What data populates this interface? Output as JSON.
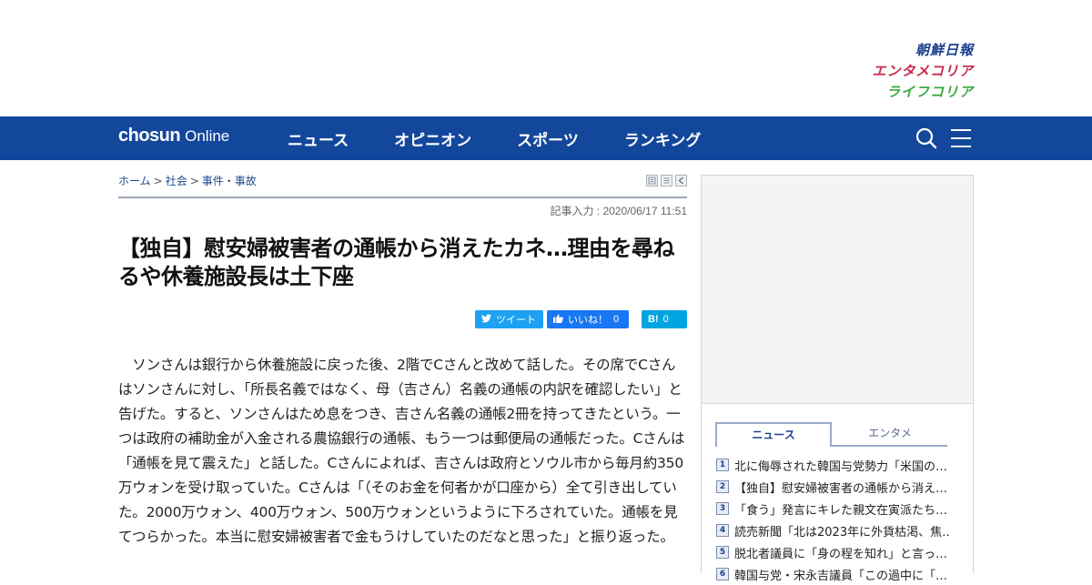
{
  "brands": {
    "chosun_ilbo": "朝鮮日報",
    "entame_korea": "エンタメコリア",
    "life_korea": "ライフコリア"
  },
  "nav": {
    "logo_main": "chosun",
    "logo_sub": "Online",
    "items": [
      "ニュース",
      "オピニオン",
      "スポーツ",
      "ランキング"
    ],
    "search_icon": "search-icon",
    "menu_icon": "menu-icon"
  },
  "breadcrumb": {
    "home": "ホーム",
    "section": "社会",
    "category": "事件・事故",
    "separator": ">"
  },
  "article": {
    "date": "記事入力 : 2020/06/17 11:51",
    "headline": "【独自】慰安婦被害者の通帳から消えたカネ…理由を尋ねるや休養施設長は土下座",
    "body": "　ソンさんは銀行から休養施設に戻った後、2階でCさんと改めて話した。その席でCさんはソンさんに対し、「所長名義ではなく、母（吉さん）名義の通帳の内訳を確認したい」と告げた。すると、ソンさんはため息をつき、吉さん名義の通帳2冊を持ってきたという。一つは政府の補助金が入金される農協銀行の通帳、もう一つは郵便局の通帳だった。Cさんは「通帳を見て震えた」と話した。Cさんによれば、吉さんは政府とソウル市から毎月約350万ウォンを受け取っていた。Cさんは「（そのお金を何者かが口座から）全て引き出していた。2000万ウォン、400万ウォン、500万ウォンというように下ろされていた。通帳を見てつらかった。本当に慰安婦被害者で金もうけしていたのだなと思った」と振り返った。"
  },
  "share": {
    "tweet": "ツイート",
    "like": "いいね！",
    "like_count": "0",
    "hatena": "B!",
    "hatena_count": "0"
  },
  "sidebar": {
    "tabs": [
      "ニュース",
      "エンタメ"
    ],
    "ranking": [
      {
        "num": "1",
        "title": "北に侮辱された韓国与党勢力「米国の…"
      },
      {
        "num": "2",
        "title": "【独自】慰安婦被害者の通帳から消え…"
      },
      {
        "num": "3",
        "title": "「食う」発言にキレた親文在寅派たち…"
      },
      {
        "num": "4",
        "title": "読売新聞「北は2023年に外貨枯渇、焦…"
      },
      {
        "num": "5",
        "title": "脱北者議員に「身の程を知れ」と言っ…"
      },
      {
        "num": "6",
        "title": "韓国与党・宋永吉議員「この過中に「…"
      }
    ]
  },
  "colors": {
    "nav_bg": "#13479c",
    "brand_blue": "#1a3f8f",
    "brand_red": "#c6284a",
    "brand_green": "#39a93d",
    "twitter": "#1da1f2",
    "facebook": "#1877f2",
    "hatena": "#00a4de"
  }
}
